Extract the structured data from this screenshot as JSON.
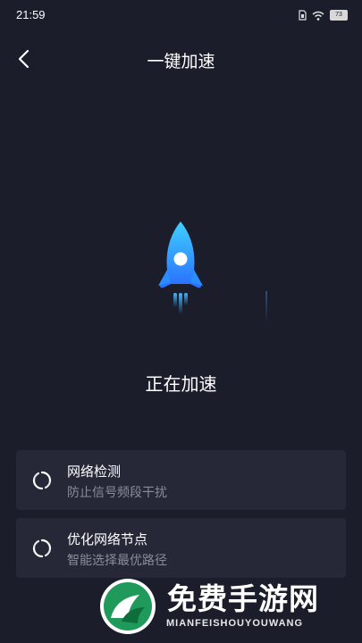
{
  "status_bar": {
    "time": "21:59",
    "battery_level": "73"
  },
  "header": {
    "title": "一键加速"
  },
  "main": {
    "status_text": "正在加速"
  },
  "tasks": [
    {
      "title": "网络检测",
      "subtitle": "防止信号频段干扰"
    },
    {
      "title": "优化网络节点",
      "subtitle": "智能选择最优路径"
    }
  ],
  "watermark": {
    "name": "免费手游网",
    "sub": "MIANFEISHOUYOUWANG"
  },
  "colors": {
    "background": "#1c1d2b",
    "card": "#262837",
    "rocket_accent": "#2fb4ff"
  }
}
